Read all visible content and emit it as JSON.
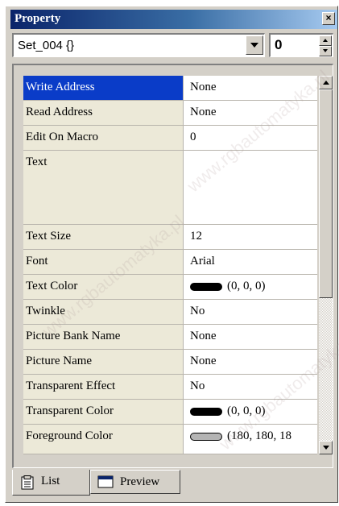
{
  "window": {
    "title": "Property",
    "close_glyph": "×"
  },
  "object_select": {
    "value": "Set_004 {}"
  },
  "spinner": {
    "value": "0"
  },
  "properties": [
    {
      "name": "Write Address",
      "value": "None"
    },
    {
      "name": "Read Address",
      "value": "None"
    },
    {
      "name": "Edit On Macro",
      "value": "0"
    },
    {
      "name": "Text",
      "value": ""
    },
    {
      "name": "Text Size",
      "value": "12"
    },
    {
      "name": "Font",
      "value": "Arial"
    },
    {
      "name": "Text Color",
      "value": "(0, 0, 0)",
      "swatch": "#000000"
    },
    {
      "name": "Twinkle",
      "value": "No"
    },
    {
      "name": "Picture Bank Name",
      "value": "None"
    },
    {
      "name": "Picture Name",
      "value": "None"
    },
    {
      "name": "Transparent Effect",
      "value": "No"
    },
    {
      "name": "Transparent Color",
      "value": "(0, 0, 0)",
      "swatch": "#000000"
    },
    {
      "name": "Foreground Color",
      "value": "(180, 180, 18",
      "swatch": "#b4b4b4"
    }
  ],
  "tabs": [
    {
      "label": "List",
      "icon": "clipboard-icon"
    },
    {
      "label": "Preview",
      "icon": "window-icon"
    }
  ],
  "watermark": "www.rgbautomatyka.pl",
  "colors": {
    "selected_row": "#0a3cc8",
    "title_gradient_start": "#0a246a",
    "title_gradient_end": "#a6caf0"
  }
}
